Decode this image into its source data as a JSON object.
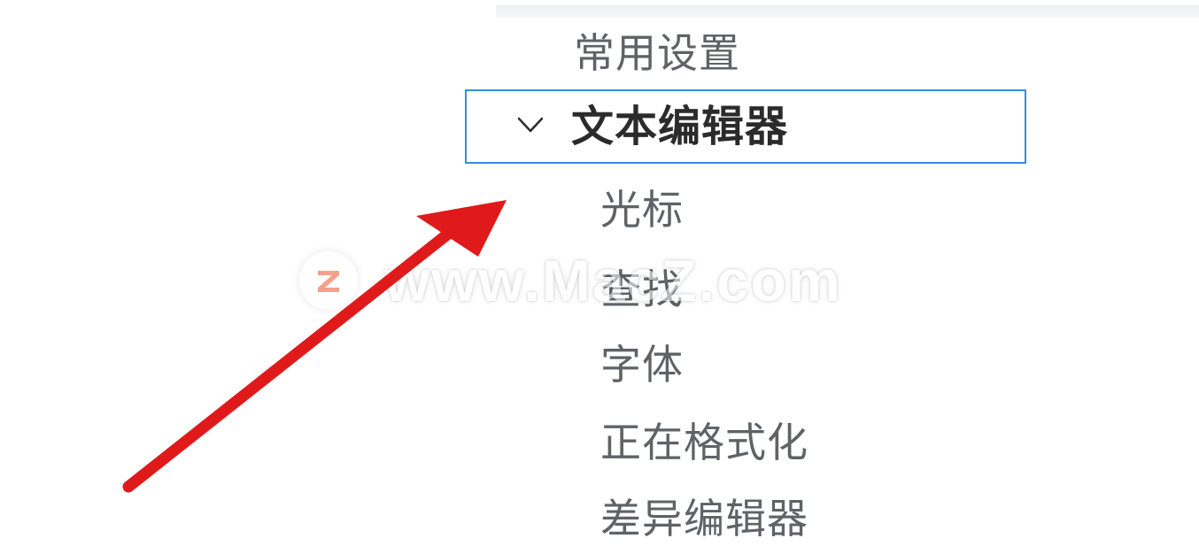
{
  "settings_tree": {
    "group_label": "常用设置",
    "selected_node": {
      "label": "文本编辑器",
      "expanded": true,
      "chevron_icon": "chevron-down-icon"
    },
    "children": [
      {
        "label": "光标"
      },
      {
        "label": "查找"
      },
      {
        "label": "字体"
      },
      {
        "label": "正在格式化"
      },
      {
        "label": "差异编辑器"
      }
    ]
  },
  "watermark": {
    "text": "www.MacZ.com",
    "logo_letter": "Z",
    "logo_color": "#f0522a"
  },
  "annotation": {
    "type": "arrow",
    "color": "#e01a1a",
    "points_to": "文本编辑器"
  },
  "colors": {
    "selection_border": "#2f8fe0",
    "text": "#5f6266",
    "selected_text": "#2b2b2b"
  }
}
